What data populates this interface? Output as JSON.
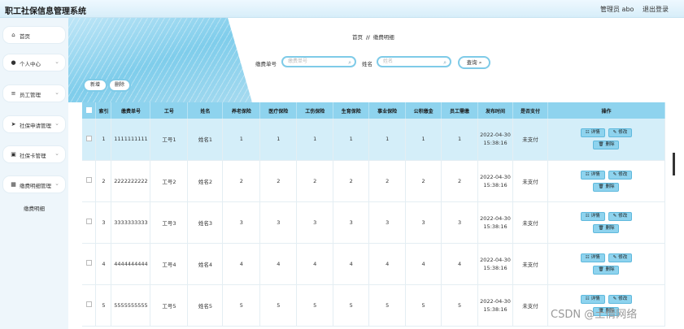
{
  "header": {
    "title": "职工社保信息管理系统",
    "admin": "管理员 abo",
    "logout": "退出登录"
  },
  "sidebar": {
    "items": [
      {
        "label": "首页",
        "icon": "home-icon",
        "glyph": "⌂"
      },
      {
        "label": "个人中心",
        "icon": "user-icon",
        "glyph": "●"
      },
      {
        "label": "员工管理",
        "icon": "list-icon",
        "glyph": "≡"
      },
      {
        "label": "社保申请管理",
        "icon": "send-icon",
        "glyph": "➤"
      },
      {
        "label": "社保卡管理",
        "icon": "lock-icon",
        "glyph": "▣"
      },
      {
        "label": "缴费明细管理",
        "icon": "grid-icon",
        "glyph": "▦"
      }
    ],
    "sub": "缴费明细"
  },
  "breadcrumb": {
    "home": "首页",
    "sep": "//",
    "current": "缴费明细"
  },
  "search": {
    "field1_label": "缴费单号",
    "field1_placeholder": "缴费单号",
    "field2_label": "姓名",
    "field2_placeholder": "姓名",
    "button": "查询"
  },
  "actions": {
    "add": "新增",
    "delete": "删除"
  },
  "table": {
    "headers": [
      "索引",
      "缴费单号",
      "工号",
      "姓名",
      "养老保险",
      "医疗保险",
      "工伤保险",
      "生育保险",
      "事业保险",
      "公积缴金",
      "员工需缴",
      "发布时间",
      "是否支付",
      "操作"
    ],
    "rows": [
      [
        "1",
        "1111111111",
        "工号1",
        "姓名1",
        "1",
        "1",
        "1",
        "1",
        "1",
        "1",
        "1",
        "2022-04-30",
        "15:38:16",
        "未支付"
      ],
      [
        "2",
        "2222222222",
        "工号2",
        "姓名2",
        "2",
        "2",
        "2",
        "2",
        "2",
        "2",
        "2",
        "2022-04-30",
        "15:38:16",
        "未支付"
      ],
      [
        "3",
        "3333333333",
        "工号3",
        "姓名3",
        "3",
        "3",
        "3",
        "3",
        "3",
        "3",
        "3",
        "2022-04-30",
        "15:38:16",
        "未支付"
      ],
      [
        "4",
        "4444444444",
        "工号4",
        "姓名4",
        "4",
        "4",
        "4",
        "4",
        "4",
        "4",
        "4",
        "2022-04-30",
        "15:38:16",
        "未支付"
      ],
      [
        "5",
        "5555555555",
        "工号5",
        "姓名5",
        "5",
        "5",
        "5",
        "5",
        "5",
        "5",
        "5",
        "2022-04-30",
        "15:38:16",
        "未支付"
      ]
    ],
    "op_detail": "详情",
    "op_edit": "修改",
    "op_delete": "删除"
  },
  "watermark": "CSDN @土倩网络",
  "colors": {
    "accent": "#8ed3ee",
    "border": "#7fcbe8",
    "selected_row": "#d4eef9"
  }
}
